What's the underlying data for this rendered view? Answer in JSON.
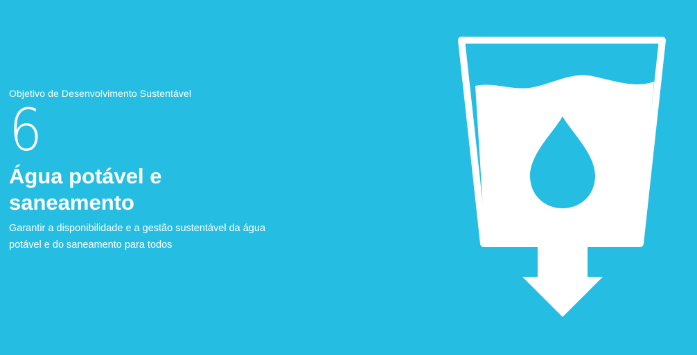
{
  "goal": {
    "kicker": "Objetivo de Desenvolvimento Sustentável",
    "number": "6",
    "title": "Água potável e saneamento",
    "description": "Garantir a disponibilidade e a gestão sustentável da água potável e do saneamento para todos"
  },
  "icon": {
    "name": "water-glass-drop-arrow-icon",
    "color": "#ffffff"
  },
  "colors": {
    "background": "#26bde2",
    "text": "#ffffff"
  }
}
